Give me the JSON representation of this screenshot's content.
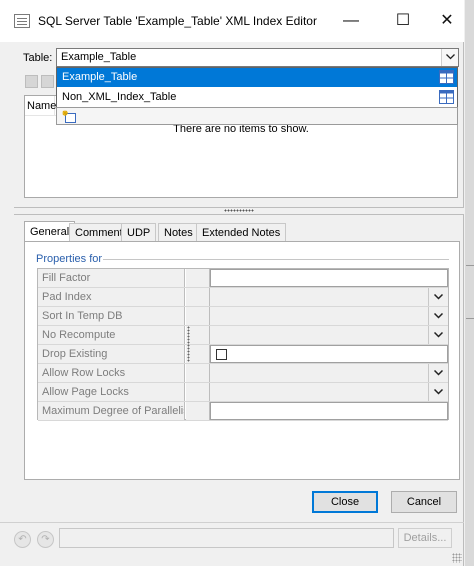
{
  "window": {
    "title": "SQL Server Table 'Example_Table' XML Index Editor",
    "minimize_glyph": "—",
    "maximize_glyph": "☐",
    "close_glyph": "✕"
  },
  "table_selector": {
    "label": "Table:",
    "value": "Example_Table",
    "options": [
      {
        "label": "Example_Table",
        "selected": true,
        "icon": "table-icon"
      },
      {
        "label": "Non_XML_Index_Table",
        "selected": false,
        "icon": "table-icon"
      }
    ]
  },
  "list": {
    "columns": [
      "Name"
    ],
    "empty_message": "There are no items to show."
  },
  "tabs": [
    {
      "label": "General",
      "active": true
    },
    {
      "label": "Comment",
      "active": false
    },
    {
      "label": "UDP",
      "active": false
    },
    {
      "label": "Notes",
      "active": false
    },
    {
      "label": "Extended Notes",
      "active": false
    }
  ],
  "properties": {
    "section_label": "Properties for",
    "rows": [
      {
        "name": "Fill Factor",
        "control": "text"
      },
      {
        "name": "Pad Index",
        "control": "dropdown"
      },
      {
        "name": "Sort In Temp DB",
        "control": "dropdown"
      },
      {
        "name": "No Recompute",
        "control": "dropdown"
      },
      {
        "name": "Drop Existing",
        "control": "checkbox",
        "checked": false
      },
      {
        "name": "Allow Row Locks",
        "control": "dropdown"
      },
      {
        "name": "Allow Page Locks",
        "control": "dropdown"
      },
      {
        "name": "Maximum Degree of Parallelism",
        "control": "text"
      }
    ]
  },
  "buttons": {
    "close": "Close",
    "cancel": "Cancel",
    "details": "Details..."
  },
  "status": {
    "undo_glyph": "↶",
    "redo_glyph": "↷"
  },
  "colors": {
    "selection": "#0078d7",
    "section_label": "#2a5fac",
    "disabled_text": "#7d7d7d"
  }
}
